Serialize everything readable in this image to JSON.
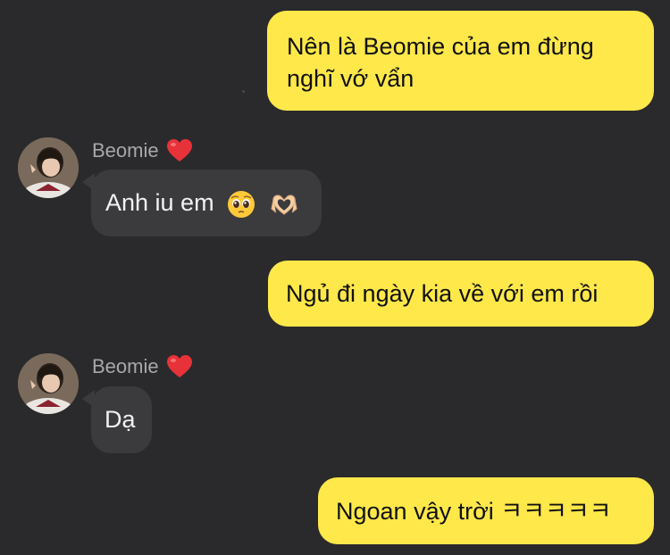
{
  "conversation": {
    "contact_name": "Beomie",
    "messages": [
      {
        "sender": "me",
        "text": "Nên là Beomie của em đừng\nnghĩ vớ vẩn"
      },
      {
        "sender": "Beomie",
        "text": "Anh iu em",
        "emojis": [
          "pleading-face-emoji",
          "heart-hands-emoji"
        ]
      },
      {
        "sender": "me",
        "text": "Ngủ đi ngày kia về với em rồi"
      },
      {
        "sender": "Beomie",
        "text": "Dạ"
      },
      {
        "sender": "me",
        "text": "Ngoan vậy trời ㅋㅋㅋㅋㅋ"
      }
    ]
  },
  "colors": {
    "background": "#2a2a2c",
    "outgoing_bubble": "#ffe84a",
    "incoming_bubble": "#3b3b3e",
    "sender_name": "#a8a8ac",
    "heart": "#e8323a"
  },
  "icons": {
    "sender_badge": "red-heart-icon"
  }
}
